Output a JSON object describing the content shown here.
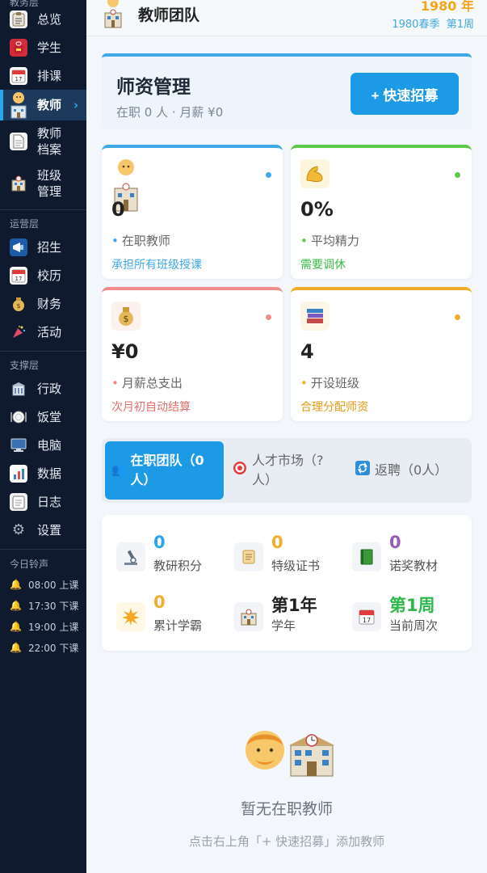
{
  "sidebar": {
    "cut_section": "教务层",
    "items_top": [
      {
        "label": "总览",
        "icon": "clipboard-icon"
      },
      {
        "label": "学生",
        "icon": "school-bag-icon"
      },
      {
        "label": "排课",
        "icon": "calendar-icon"
      },
      {
        "label": "教师",
        "icon": "teacher-icon",
        "active": true
      },
      {
        "label": "教师档案",
        "icon": "document-icon"
      },
      {
        "label": "班级管理",
        "icon": "school-building-icon"
      }
    ],
    "section_ops": "运营层",
    "items_ops": [
      {
        "label": "招生",
        "icon": "megaphone-icon"
      },
      {
        "label": "校历",
        "icon": "calendar-icon"
      },
      {
        "label": "财务",
        "icon": "money-bag-icon"
      },
      {
        "label": "活动",
        "icon": "party-popper-icon"
      }
    ],
    "section_support": "支撑层",
    "items_support": [
      {
        "label": "行政",
        "icon": "office-icon"
      },
      {
        "label": "饭堂",
        "icon": "plate-icon"
      },
      {
        "label": "电脑",
        "icon": "computer-icon"
      },
      {
        "label": "数据",
        "icon": "bar-chart-icon"
      },
      {
        "label": "日志",
        "icon": "log-icon"
      },
      {
        "label": "设置",
        "icon": "gear-icon"
      }
    ],
    "bells_title": "今日铃声",
    "bells": [
      "08:00 上课",
      "17:30 下课",
      "19:00 上课",
      "22:00 下课"
    ]
  },
  "header": {
    "title": "教师团队",
    "year": "1980 年",
    "season": "1980春季",
    "week": "第1周"
  },
  "panel": {
    "title": "师资管理",
    "subtitle": "在职 0 人 · 月薪 ¥0",
    "recruit_button": "+ 快速招募"
  },
  "stats": [
    {
      "value": "0",
      "label": "在职教师",
      "hint": "承担所有班级授课",
      "color": "#3fa8e6",
      "icon": "teacher-icon"
    },
    {
      "value": "0%",
      "label": "平均精力",
      "hint": "需要调休",
      "color": "#5cc94a",
      "icon": "flexed-biceps-icon"
    },
    {
      "value": "¥0",
      "label": "月薪总支出",
      "hint": "次月初自动结算",
      "color": "#ef8c8c",
      "icon": "money-bag-icon"
    },
    {
      "value": "4",
      "label": "开设班级",
      "hint": "合理分配师资",
      "color": "#f0ae2a",
      "icon": "books-icon"
    }
  ],
  "tabs": [
    {
      "label": "在职团队（0人）",
      "icon": "people-icon",
      "active": true
    },
    {
      "label": "人才市场（?人）",
      "icon": "target-icon",
      "active": false
    },
    {
      "label": "返聘（0人）",
      "icon": "refresh-icon",
      "active": false
    }
  ],
  "metrics": [
    {
      "value": "0",
      "label": "教研积分",
      "color": "#2aa6ea",
      "icon": "microscope-icon"
    },
    {
      "value": "0",
      "label": "特级证书",
      "color": "#f0ae2a",
      "icon": "scroll-icon"
    },
    {
      "value": "0",
      "label": "诺奖教材",
      "color": "#9b59b6",
      "icon": "green-book-icon"
    },
    {
      "value": "0",
      "label": "累计学霸",
      "color": "#f0ae2a",
      "icon": "star-burst-icon"
    },
    {
      "value": "第1年",
      "label": "学年",
      "color": "#222222",
      "icon": "school-building-icon"
    },
    {
      "value": "第1周",
      "label": "当前周次",
      "color": "#2eb84a",
      "icon": "calendar-icon"
    }
  ],
  "empty": {
    "title": "暂无在职教师",
    "subtitle": "点击右上角「+ 快速招募」添加教师"
  }
}
